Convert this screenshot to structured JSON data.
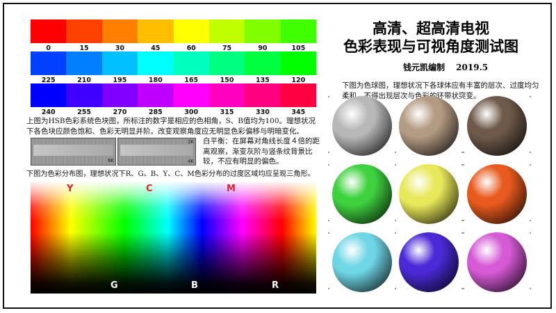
{
  "hue_rows": [
    {
      "labels": [
        "0",
        "15",
        "30",
        "45",
        "60",
        "75",
        "90",
        "105"
      ],
      "colors": [
        "#ff0000",
        "#ff4000",
        "#ff8000",
        "#ffbf00",
        "#ffff00",
        "#bfff00",
        "#80ff00",
        "#40ff00"
      ]
    },
    {
      "labels": [
        "225",
        "210",
        "195",
        "180",
        "165",
        "150",
        "135",
        "120"
      ],
      "colors": [
        "#0040ff",
        "#0080ff",
        "#00bfff",
        "#00ffff",
        "#00ffbf",
        "#00ff80",
        "#00ff40",
        "#00ff00"
      ]
    },
    {
      "labels": [
        "240",
        "255",
        "270",
        "285",
        "300",
        "315",
        "330",
        "345"
      ],
      "colors": [
        "#0000ff",
        "#4000ff",
        "#8000ff",
        "#bf00ff",
        "#ff00ff",
        "#ff00bf",
        "#ff0080",
        "#ff0040"
      ]
    }
  ],
  "hsb_note": "上图为HSB色彩系统色块图，所标注的数字是相应的色相角，S、B值均为100。理想状况下各色块应颜色饱和、色彩无明显并阶。改变观察角度应无明显色彩偏移与明暗变化。",
  "gray_labels": {
    "k8": "8K",
    "k2": "2K",
    "k4": "4K"
  },
  "white_balance_note": "白平衡：在屏幕对角线长度４倍的距离观察，渐变灰阶与竖条纹背景比较，不应有明显的偏色。",
  "color_map_note": "下图为色彩分布图，理想状况下R、G、B、Y、C、M色彩分布的过度区域均应呈现三角形。",
  "color_map_labels": {
    "y": "Y",
    "c": "C",
    "m": "M",
    "g": "G",
    "b": "B",
    "r": "R"
  },
  "title_line1": "高清、超高清电视",
  "title_line2": "色彩表现与可视角度测试图",
  "author": "钱元凯编制　 2019.5",
  "sphere_note": "下图为色球图，理想状况下各球体应有丰富的层次、过度均匀柔和，不得出现层次与色彩的环带状突变。",
  "spheres": [
    {
      "name": "gray-sphere",
      "color": "#b8b8b8"
    },
    {
      "name": "tan-sphere",
      "color": "#b39a82"
    },
    {
      "name": "brown-sphere",
      "color": "#6f5a4a"
    },
    {
      "name": "green-sphere",
      "color": "#3fd23f"
    },
    {
      "name": "yellow-sphere",
      "color": "#e8e85a"
    },
    {
      "name": "orange-sphere",
      "color": "#e85a1e"
    },
    {
      "name": "cyan-sphere",
      "color": "#6fd6e6"
    },
    {
      "name": "blue-violet-sphere",
      "color": "#4a2ad6"
    },
    {
      "name": "magenta-sphere",
      "color": "#d65ad6"
    }
  ]
}
